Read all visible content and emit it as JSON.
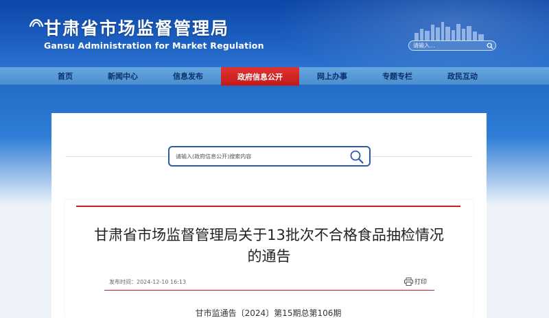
{
  "header": {
    "title_cn": "甘肃省市场监督管理局",
    "title_en": "Gansu Administration for Market Regulation",
    "search_placeholder": "请输入..."
  },
  "nav": {
    "items": [
      {
        "label": "首页"
      },
      {
        "label": "新闻中心"
      },
      {
        "label": "信息发布"
      },
      {
        "label": "政府信息公开",
        "active": true
      },
      {
        "label": "网上办事"
      },
      {
        "label": "专题专栏"
      },
      {
        "label": "政民互动"
      }
    ]
  },
  "search": {
    "placeholder": "请输入(政府信息公开)搜索内容"
  },
  "article": {
    "title": "甘肃省市场监督管理局关于13批次不合格食品抽检情况的通告",
    "publish_time": "发布时间：2024-12-10 16:13",
    "print_label": "打印",
    "doc_number": "甘市监通告〔2024〕第15期总第106期"
  },
  "colors": {
    "header_blue": "#0b46a8",
    "nav_blue": "#5b9bd8",
    "active_red": "#d12424",
    "accent_red": "#c81e1e",
    "search_border": "#2d5aa6"
  },
  "icons": {
    "emblem": "emblem-icon",
    "header_search": "search-icon",
    "main_search": "search-icon",
    "print": "printer-icon"
  }
}
